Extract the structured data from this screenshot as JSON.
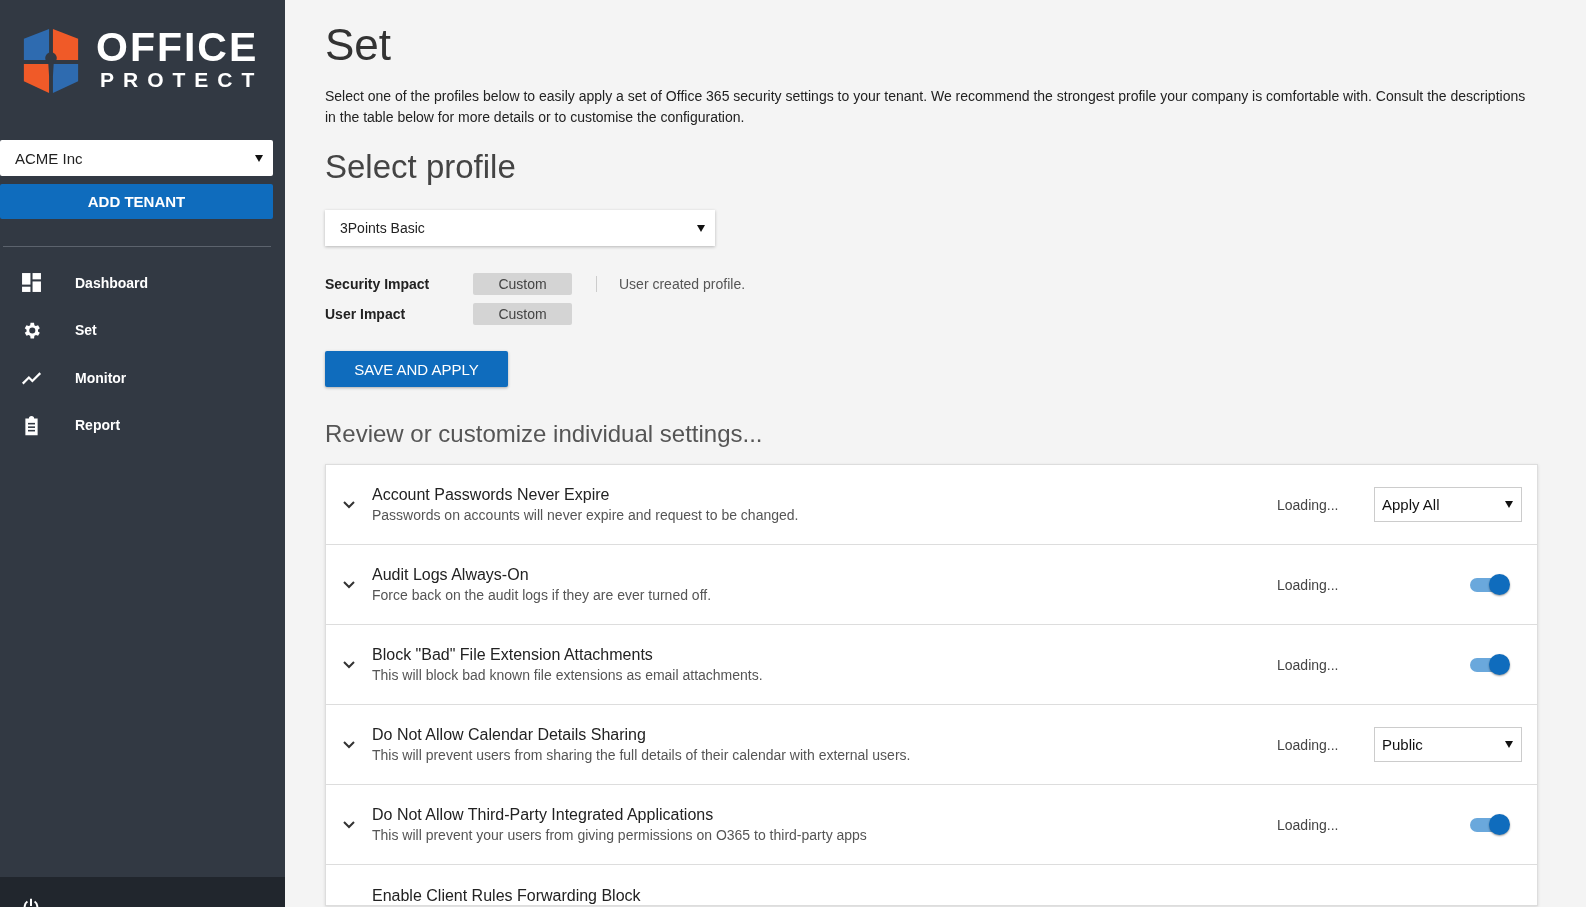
{
  "sidebar": {
    "logo": {
      "line_1": "OFFICE",
      "line_2": "PROTECT"
    },
    "tenant_select": {
      "value": "ACME Inc"
    },
    "add_tenant_button": "ADD TENANT",
    "nav_items": [
      {
        "label": "Dashboard",
        "kind": "dashboard"
      },
      {
        "label": "Set",
        "kind": "set"
      },
      {
        "label": "Monitor",
        "kind": "monitor"
      },
      {
        "label": "Report",
        "kind": "report"
      }
    ],
    "footer_item": {
      "kind": "power"
    }
  },
  "page": {
    "title": "Set",
    "intro": "Select one of the profiles below to easily apply a set of Office 365 security settings to your tenant. We recommend the strongest profile your company is comfortable with. Consult the descriptions in the table below for more details or to customise the configuration.",
    "profile_heading": "Select profile",
    "profile_select": {
      "value": "3Points Basic"
    },
    "impacts": [
      {
        "label": "Security Impact",
        "value": "Custom"
      },
      {
        "label": "User Impact",
        "value": "Custom"
      }
    ],
    "profile_note": "User created profile.",
    "save_button": "SAVE AND APPLY",
    "settings_heading": "Review or customize individual settings...",
    "settings": [
      {
        "title": "Account Passwords Never Expire",
        "description": "Passwords on accounts will never expire and request to be changed.",
        "status": "Loading...",
        "kind": "select",
        "value": "Apply All"
      },
      {
        "title": "Audit Logs Always-On",
        "description": "Force back on the audit logs if they are ever turned off.",
        "status": "Loading...",
        "kind": "toggle",
        "on": true
      },
      {
        "title": "Block \"Bad\" File Extension Attachments",
        "description": "This will block bad known file extensions as email attachments.",
        "status": "Loading...",
        "kind": "toggle",
        "on": true
      },
      {
        "title": "Do Not Allow Calendar Details Sharing",
        "description": "This will prevent users from sharing the full details of their calendar with external users.",
        "status": "Loading...",
        "kind": "select",
        "value": "Public"
      },
      {
        "title": "Do Not Allow Third-Party Integrated Applications",
        "description": "This will prevent your users from giving permissions on O365 to third-party apps",
        "status": "Loading...",
        "kind": "toggle",
        "on": true
      },
      {
        "title": "Enable Client Rules Forwarding Block",
        "kind": "partial"
      }
    ]
  }
}
